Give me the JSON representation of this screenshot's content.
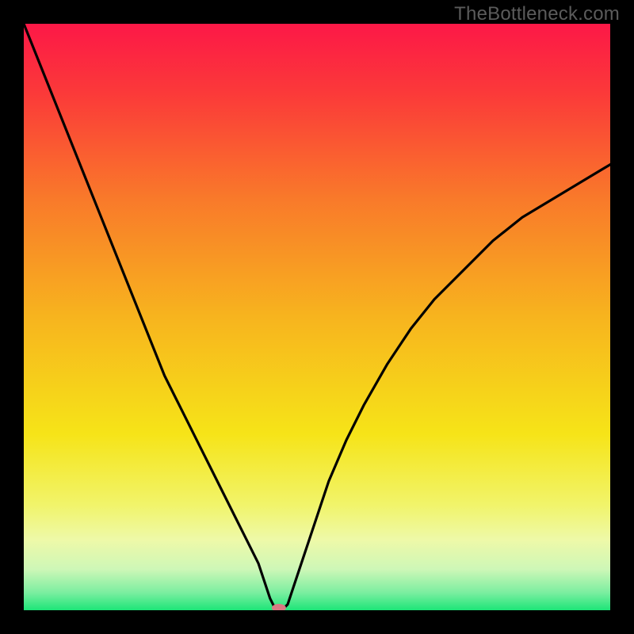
{
  "watermark": "TheBottleneck.com",
  "chart_data": {
    "type": "line",
    "title": "",
    "xlabel": "",
    "ylabel": "",
    "xlim": [
      0,
      100
    ],
    "ylim": [
      0,
      100
    ],
    "x": [
      0,
      2,
      4,
      6,
      8,
      10,
      12,
      14,
      16,
      18,
      20,
      22,
      24,
      26,
      28,
      30,
      32,
      34,
      36,
      38,
      40,
      41,
      42,
      43,
      44,
      45,
      46,
      48,
      50,
      52,
      55,
      58,
      62,
      66,
      70,
      75,
      80,
      85,
      90,
      95,
      100
    ],
    "values": [
      100,
      95,
      90,
      85,
      80,
      75,
      70,
      65,
      60,
      55,
      50,
      45,
      40,
      36,
      32,
      28,
      24,
      20,
      16,
      12,
      8,
      5,
      2,
      0,
      0,
      1,
      4,
      10,
      16,
      22,
      29,
      35,
      42,
      48,
      53,
      58,
      63,
      67,
      70,
      73,
      76
    ],
    "gradient_stops": [
      {
        "offset": 0.0,
        "color": "#fc1847"
      },
      {
        "offset": 0.12,
        "color": "#fb3a39"
      },
      {
        "offset": 0.3,
        "color": "#f97a2a"
      },
      {
        "offset": 0.5,
        "color": "#f7b41e"
      },
      {
        "offset": 0.7,
        "color": "#f6e418"
      },
      {
        "offset": 0.82,
        "color": "#f1f46a"
      },
      {
        "offset": 0.88,
        "color": "#eef9a8"
      },
      {
        "offset": 0.93,
        "color": "#cef7b7"
      },
      {
        "offset": 0.97,
        "color": "#7beea0"
      },
      {
        "offset": 1.0,
        "color": "#1de578"
      }
    ],
    "marker": {
      "x": 43.5,
      "y": 0.4,
      "color": "#d97a83",
      "rx": 9,
      "ry": 5
    }
  }
}
